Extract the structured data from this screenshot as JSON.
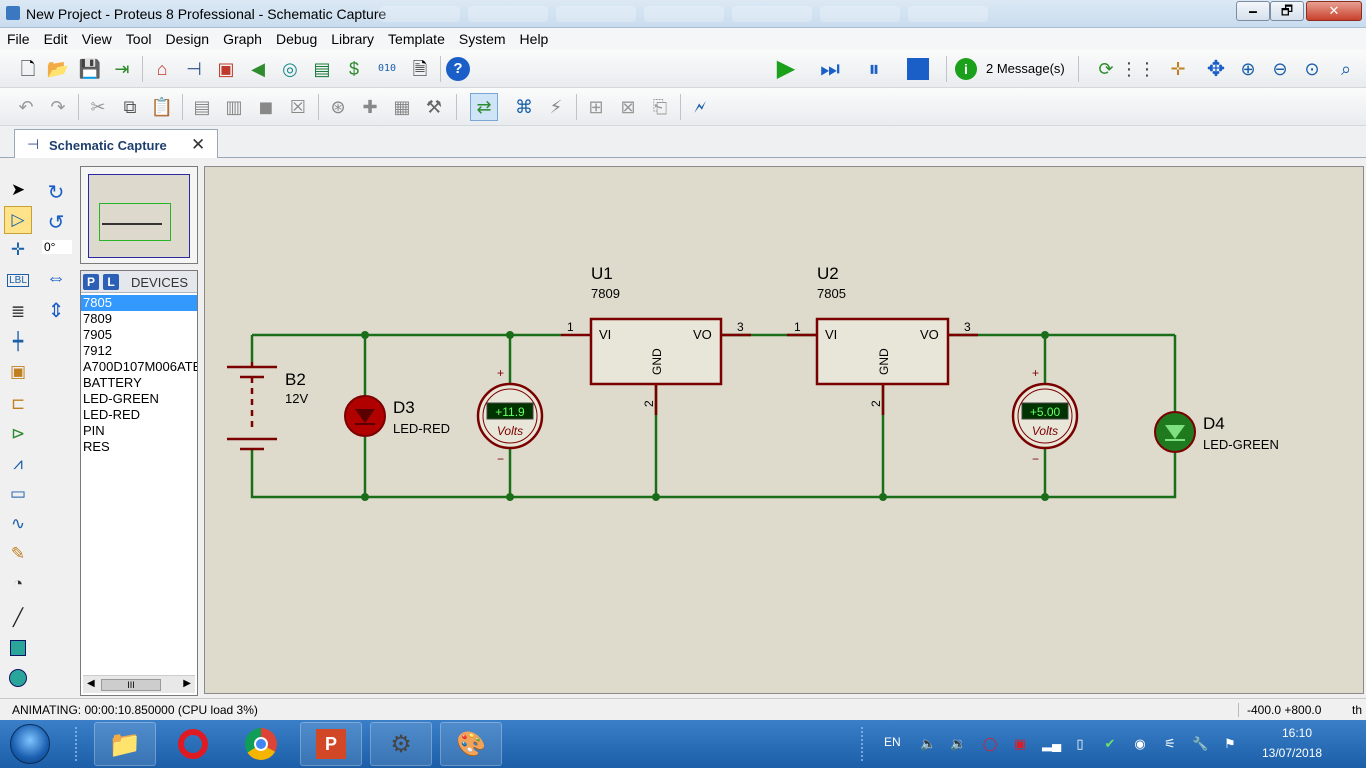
{
  "window": {
    "title": "New Project - Proteus 8 Professional - Schematic Capture",
    "min": "🗕",
    "max": "🗗",
    "close": "✕"
  },
  "menu": [
    "File",
    "Edit",
    "View",
    "Tool",
    "Design",
    "Graph",
    "Debug",
    "Library",
    "Template",
    "System",
    "Help"
  ],
  "toolbar": {
    "messages": "2 Message(s)"
  },
  "tab": {
    "label": "Schematic Capture",
    "close": "✕"
  },
  "left": {
    "angle": "0°"
  },
  "devices": {
    "p_label": "P",
    "l_label": "L",
    "title": "DEVICES",
    "items": [
      "7805",
      "7809",
      "7905",
      "7912",
      "A700D107M006ATE",
      "BATTERY",
      "LED-GREEN",
      "LED-RED",
      "PIN",
      "RES"
    ],
    "selected": 0,
    "scroll_thumb": "III"
  },
  "schematic": {
    "b2": {
      "ref": "B2",
      "value": "12V"
    },
    "d3": {
      "ref": "D3",
      "value": "LED-RED"
    },
    "d4": {
      "ref": "D4",
      "value": "LED-GREEN"
    },
    "u1": {
      "ref": "U1",
      "value": "7809",
      "vi": "VI",
      "vo": "VO",
      "gnd": "GND",
      "pin_in": "1",
      "pin_out": "3",
      "pin_gnd": "2"
    },
    "u2": {
      "ref": "U2",
      "value": "7805",
      "vi": "VI",
      "vo": "VO",
      "gnd": "GND",
      "pin_in": "1",
      "pin_out": "3",
      "pin_gnd": "2"
    },
    "vm1": {
      "reading": "+11.9",
      "unit": "Volts",
      "plus": "+",
      "minus": "−"
    },
    "vm2": {
      "reading": "+5.00",
      "unit": "Volts",
      "plus": "+",
      "minus": "−"
    },
    "colors": {
      "wire": "#1a6e1a",
      "body": "#7a0000",
      "fill": "#e8e6d8",
      "display": "#003300",
      "display_text": "#66ff66"
    }
  },
  "status": {
    "text": "ANIMATING: 00:00:10.850000 (CPU load 3%)",
    "coords": "-400.0  +800.0",
    "unit": "th"
  },
  "taskbar": {
    "lang": "EN",
    "time": "16:10",
    "date": "13/07/2018"
  }
}
